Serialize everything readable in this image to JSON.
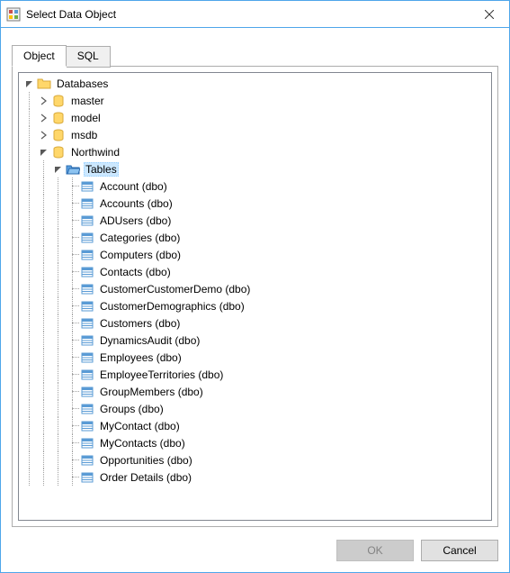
{
  "window": {
    "title": "Select Data Object"
  },
  "tabs": {
    "object": "Object",
    "sql": "SQL"
  },
  "tree": {
    "root": "Databases",
    "dbs": {
      "master": "master",
      "model": "model",
      "msdb": "msdb",
      "northwind": "Northwind"
    },
    "tables_label": "Tables",
    "tables": [
      "Account (dbo)",
      "Accounts (dbo)",
      "ADUsers (dbo)",
      "Categories (dbo)",
      "Computers (dbo)",
      "Contacts (dbo)",
      "CustomerCustomerDemo (dbo)",
      "CustomerDemographics (dbo)",
      "Customers (dbo)",
      "DynamicsAudit (dbo)",
      "Employees (dbo)",
      "EmployeeTerritories (dbo)",
      "GroupMembers (dbo)",
      "Groups (dbo)",
      "MyContact (dbo)",
      "MyContacts (dbo)",
      "Opportunities (dbo)",
      "Order Details (dbo)"
    ]
  },
  "buttons": {
    "ok": "OK",
    "cancel": "Cancel"
  }
}
